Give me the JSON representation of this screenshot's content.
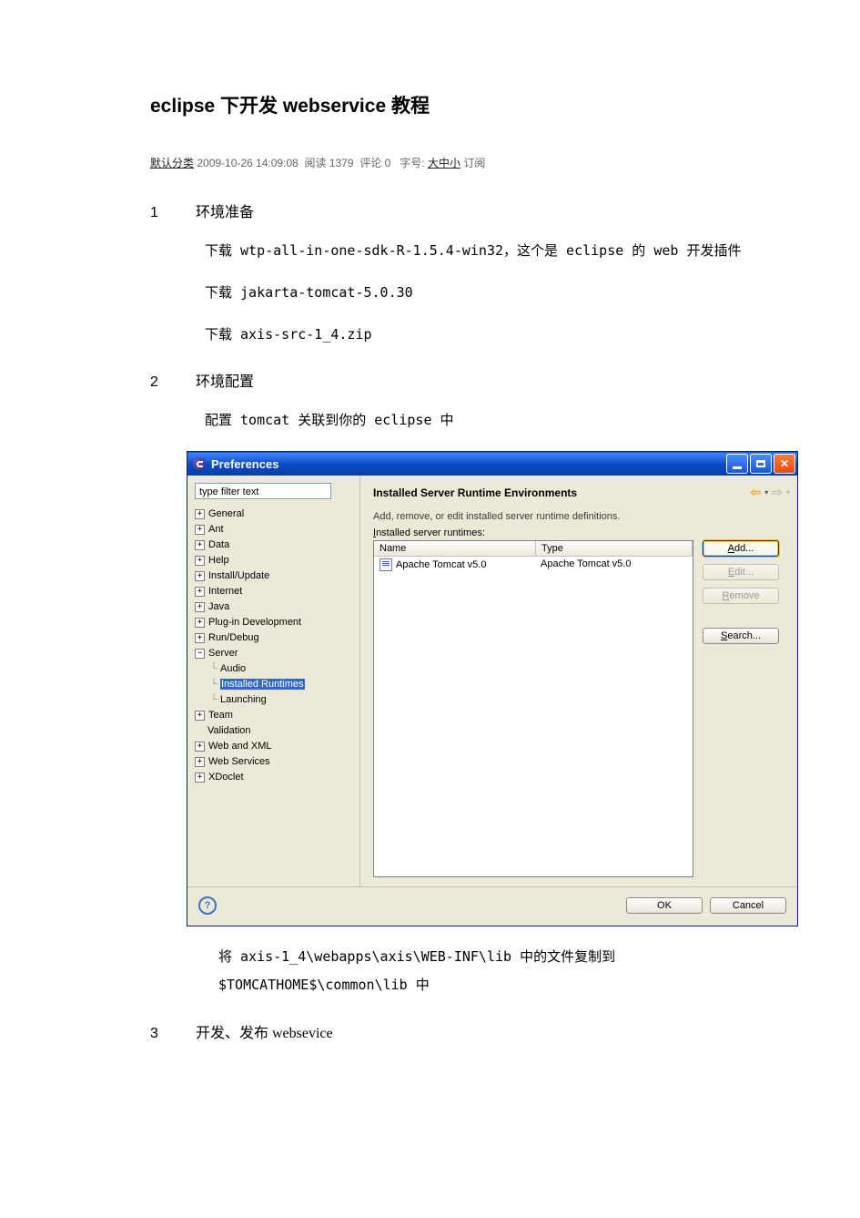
{
  "title": "eclipse 下开发 webservice 教程",
  "meta": {
    "category": "默认分类",
    "datetime": "2009-10-26 14:09:08",
    "reads_label": "阅读",
    "reads": "1379",
    "comments_label": "评论",
    "comments": "0",
    "font_label": "字号:",
    "font_opts": "大中小",
    "subscribe": "订阅"
  },
  "sections": {
    "s1": {
      "num": "1",
      "head": "环境准备"
    },
    "s1_p1": "下载 wtp-all-in-one-sdk-R-1.5.4-win32，这个是 eclipse 的 web 开发插件",
    "s1_p2": "下载 jakarta-tomcat-5.0.30",
    "s1_p3": "下载 axis-src-1_4.zip",
    "s2": {
      "num": "2",
      "head": "环境配置"
    },
    "s2_p1": "配置 tomcat 关联到你的 eclipse 中",
    "post1": "   将 axis-1_4\\webapps\\axis\\WEB-INF\\lib 中的文件复制到",
    "post2": "$TOMCATHOME$\\common\\lib 中",
    "s3": {
      "num": "3",
      "head": "开发、发布 websevice"
    }
  },
  "dlg": {
    "title": "Preferences",
    "filter": "type filter text",
    "tree": {
      "general": "General",
      "ant": "Ant",
      "data": "Data",
      "help": "Help",
      "install": "Install/Update",
      "internet": "Internet",
      "java": "Java",
      "plugin": "Plug-in Development",
      "run": "Run/Debug",
      "server": "Server",
      "audio": "Audio",
      "inst": "Installed Runtimes",
      "launch": "Launching",
      "team": "Team",
      "validation": "Validation",
      "webxml": "Web and XML",
      "webservices": "Web Services",
      "xdoclet": "XDoclet"
    },
    "main": {
      "title": "Installed Server Runtime Environments",
      "desc": "Add, remove, or edit installed server runtime definitions.",
      "sub_pre": "I",
      "sub_rest": "nstalled server runtimes:",
      "col_name": "Name",
      "col_type": "Type",
      "row_name": "Apache Tomcat v5.0",
      "row_type": "Apache Tomcat v5.0"
    },
    "btns": {
      "add_pre": "A",
      "add_rest": "dd...",
      "edit_pre": "E",
      "edit_rest": "dit...",
      "remove_pre": "R",
      "remove_rest": "emove",
      "search_pre": "S",
      "search_rest": "earch..."
    },
    "footer": {
      "help": "?",
      "ok": "OK",
      "cancel": "Cancel"
    }
  }
}
